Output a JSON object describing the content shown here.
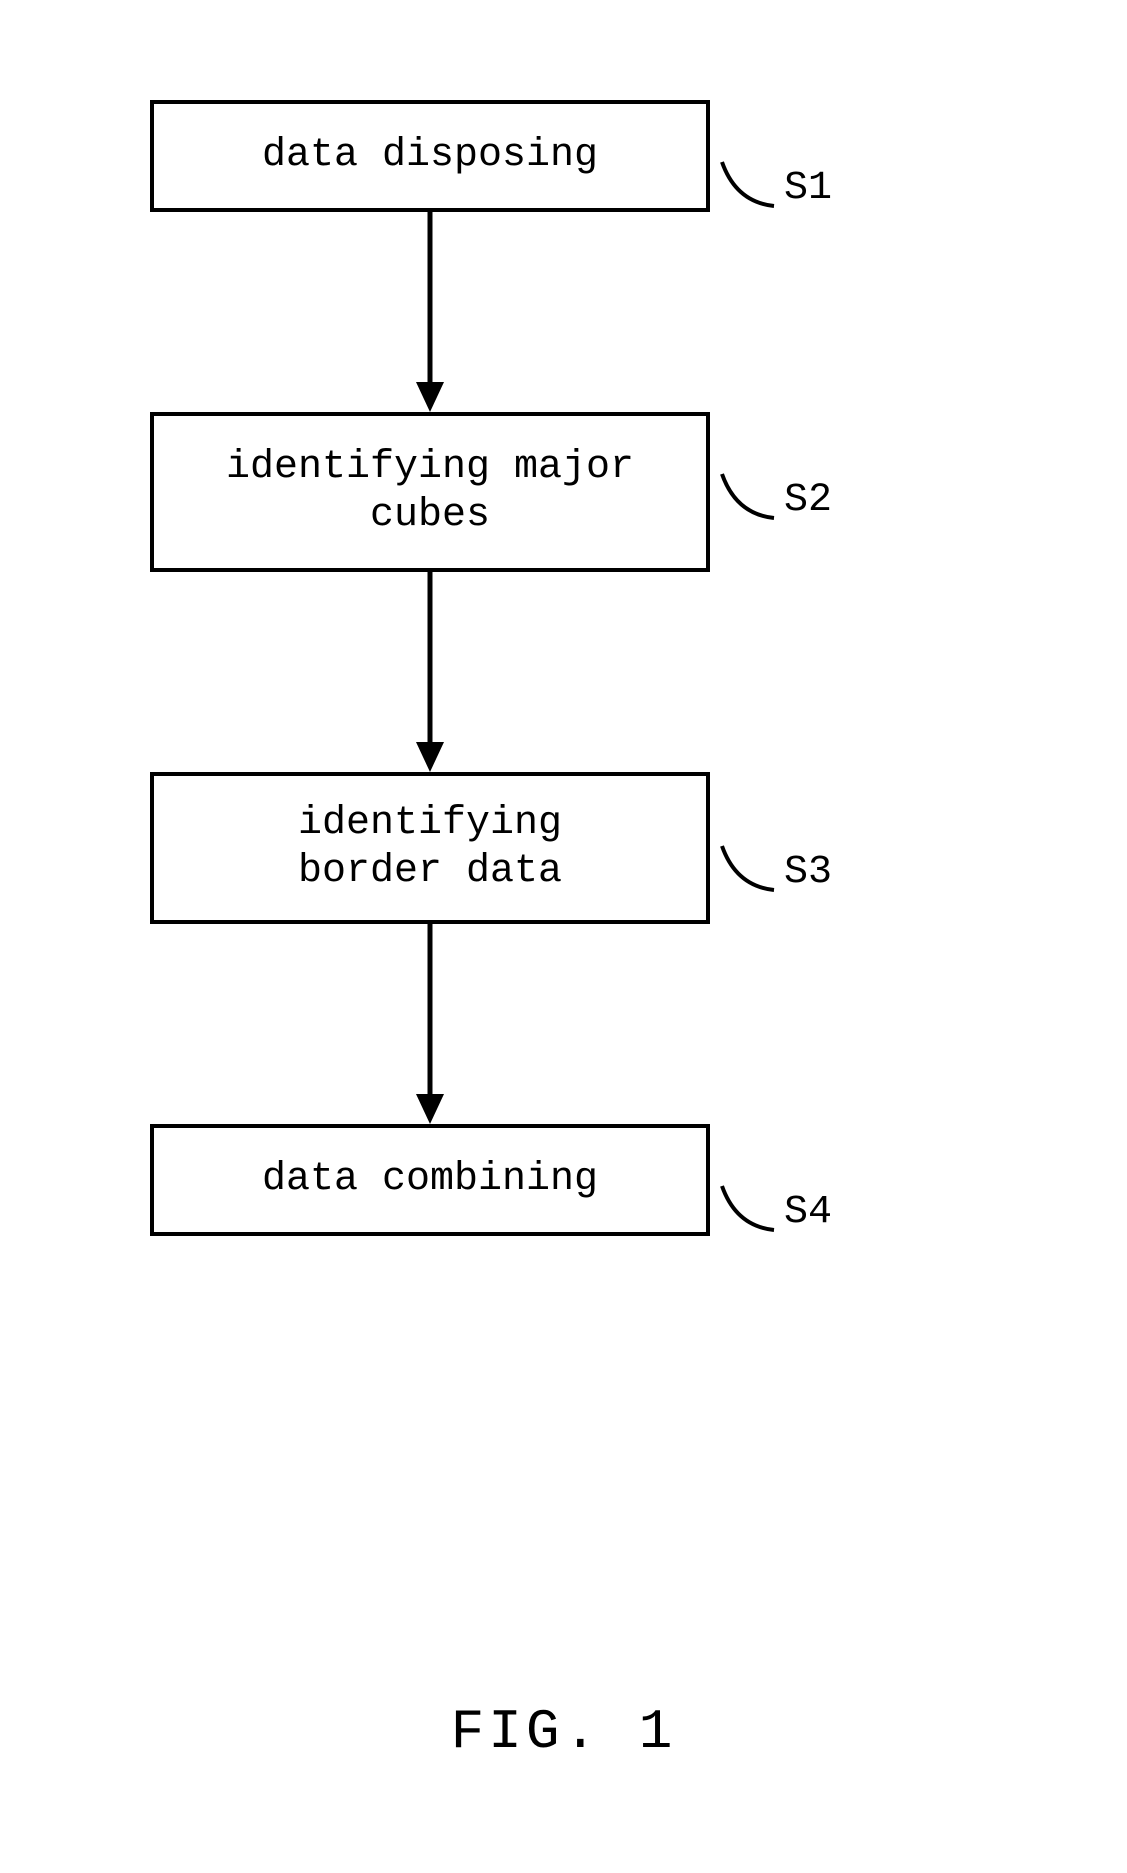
{
  "diagram": {
    "steps": [
      {
        "text": "data disposing",
        "label": "S1"
      },
      {
        "text": "identifying major cubes",
        "label": "S2"
      },
      {
        "text": "identifying\nborder data",
        "label": "S3"
      },
      {
        "text": "data combining",
        "label": "S4"
      }
    ],
    "caption": "FIG. 1"
  }
}
